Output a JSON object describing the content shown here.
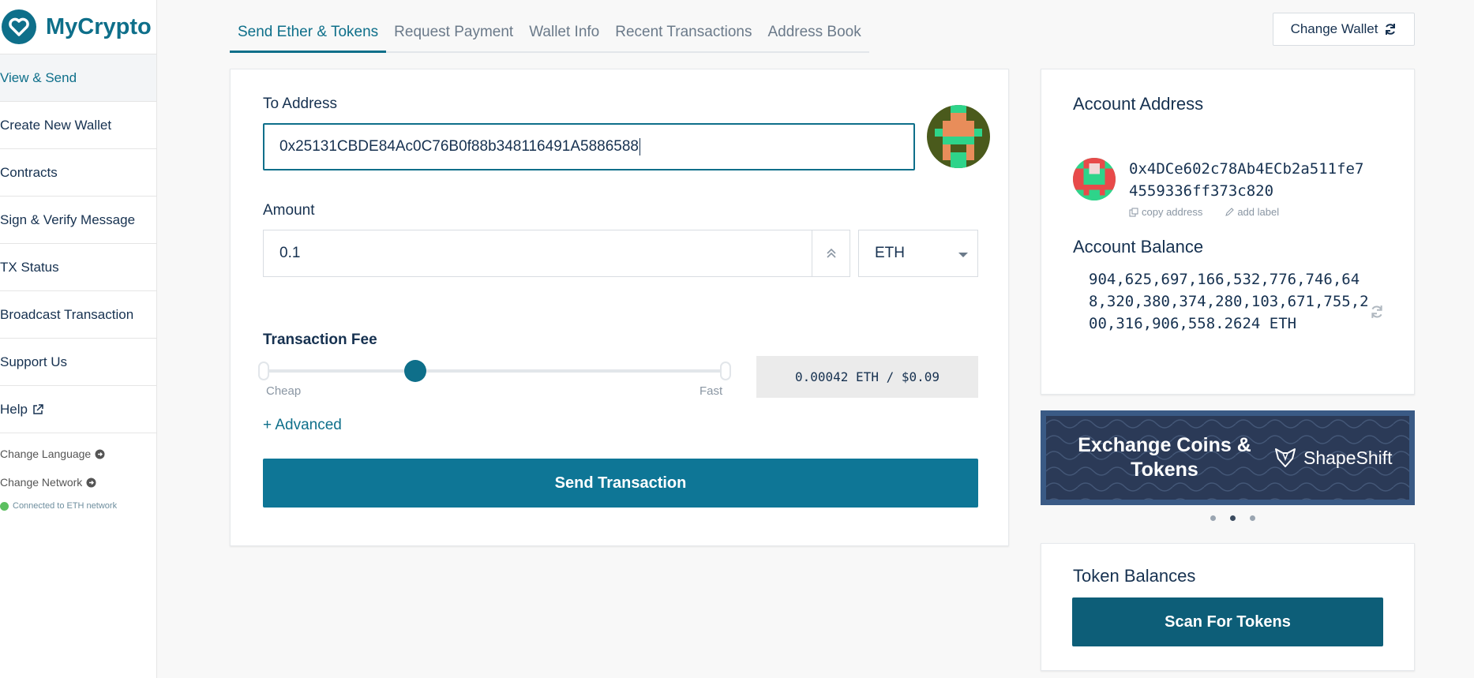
{
  "app": {
    "name": "MyCrypto"
  },
  "sidebar": {
    "items": [
      {
        "label": "View & Send",
        "active": true
      },
      {
        "label": "Create New Wallet"
      },
      {
        "label": "Contracts"
      },
      {
        "label": "Sign & Verify Message"
      },
      {
        "label": "TX Status"
      },
      {
        "label": "Broadcast Transaction"
      },
      {
        "label": "Support Us"
      },
      {
        "label": "Help"
      }
    ],
    "change_language": "Change Language",
    "change_network": "Change Network",
    "status": "Connected to ETH network"
  },
  "tabs": [
    {
      "label": "Send Ether & Tokens",
      "active": true
    },
    {
      "label": "Request Payment"
    },
    {
      "label": "Wallet Info"
    },
    {
      "label": "Recent Transactions"
    },
    {
      "label": "Address Book"
    }
  ],
  "header": {
    "change_wallet_label": "Change Wallet"
  },
  "send": {
    "to_label": "To Address",
    "to_value": "0x25131CBDE84Ac0C76B0f88b348116491A5886588",
    "amount_label": "Amount",
    "amount_value": "0.1",
    "unit": "ETH",
    "fee_label": "Transaction Fee",
    "fee_position": 0.33,
    "cheap_label": "Cheap",
    "fast_label": "Fast",
    "fee_value": "0.00042 ETH / $0.09",
    "advanced_label": "+ Advanced",
    "send_label": "Send Transaction"
  },
  "account": {
    "title": "Account Address",
    "address": "0x4DCe602c78Ab4ECb2a511fe74559336ff373c820",
    "copy_label": "copy address",
    "label_label": "add label",
    "balance_title": "Account Balance",
    "balance": "904,625,697,166,532,776,746,648,320,380,374,280,103,671,755,200,316,906,558.2624 ETH"
  },
  "promo": {
    "text": "Exchange Coins & Tokens",
    "brand": "ShapeShift"
  },
  "tokens": {
    "title": "Token Balances",
    "scan_label": "Scan For Tokens"
  },
  "colors": {
    "accent": "#0e6f8a",
    "status_green": "#5cbf60"
  }
}
